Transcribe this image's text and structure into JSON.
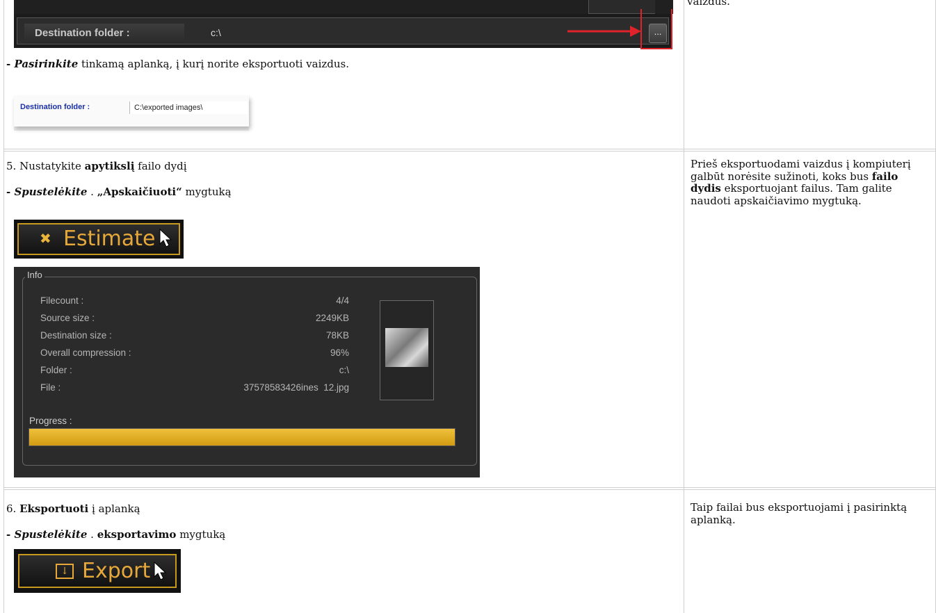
{
  "rows": {
    "row4": {
      "dest_dark_label": "Destination folder :",
      "dest_dark_value": "c:\\",
      "browse_label": "...",
      "instruction_prefix": "- ",
      "instruction_bold": "Pasirinkite",
      "instruction_rest": " tinkamą aplanką, į kurį norite eksportuoti vaizdus.",
      "dest_light_label": "Destination folder :",
      "dest_light_value": "C:\\exported images\\",
      "side_text_top": "vaizdus."
    },
    "row5": {
      "heading_prefix": "5. Nustatykite ",
      "heading_bold": "apytikslį",
      "heading_rest": " failo dydį",
      "step_prefix": "- ",
      "step_bold_italic": "Spustelėkite",
      "step_middle": " . ",
      "step_bold": "„Apskaičiuoti“",
      "step_rest": " mygtuką",
      "estimate_label": "Estimate",
      "side_1": "Prieš eksportuodami vaizdus į kompiuterį galbūt norėsite sužinoti, koks bus ",
      "side_bold": "failo dydis",
      "side_2": " eksportuojant failus. Tam galite naudoti apskaičiavimo mygtuką."
    },
    "info": {
      "title": "Info",
      "rows": [
        {
          "label": "Filecount :",
          "value": "4/4"
        },
        {
          "label": "Source size :",
          "value": "2249KB"
        },
        {
          "label": "Destination size :",
          "value": "78KB"
        },
        {
          "label": "Overall compression :",
          "value": "96%"
        },
        {
          "label": "Folder :",
          "value": "c:\\"
        },
        {
          "label": "File :",
          "value": "37578583426ines  12.jpg"
        }
      ],
      "progress_label": "Progress :",
      "progress": 1.0,
      "progress_color": "#e2ad25"
    },
    "row6": {
      "heading_prefix": "6. ",
      "heading_bold": "Eksportuoti",
      "heading_rest": " į aplanką",
      "step_prefix": "- ",
      "step_bold_italic": "Spustelėkite",
      "step_middle": " . ",
      "step_bold": "eksportavimo",
      "step_rest": " mygtuką",
      "export_label": "Export",
      "side_text": "Taip failai bus eksportuojami į pasirinktą aplanką."
    }
  },
  "colors": {
    "accent_gold": "#c79a1f",
    "arrow_red": "#e0222a",
    "dest_blue": "#1a2fa8"
  }
}
